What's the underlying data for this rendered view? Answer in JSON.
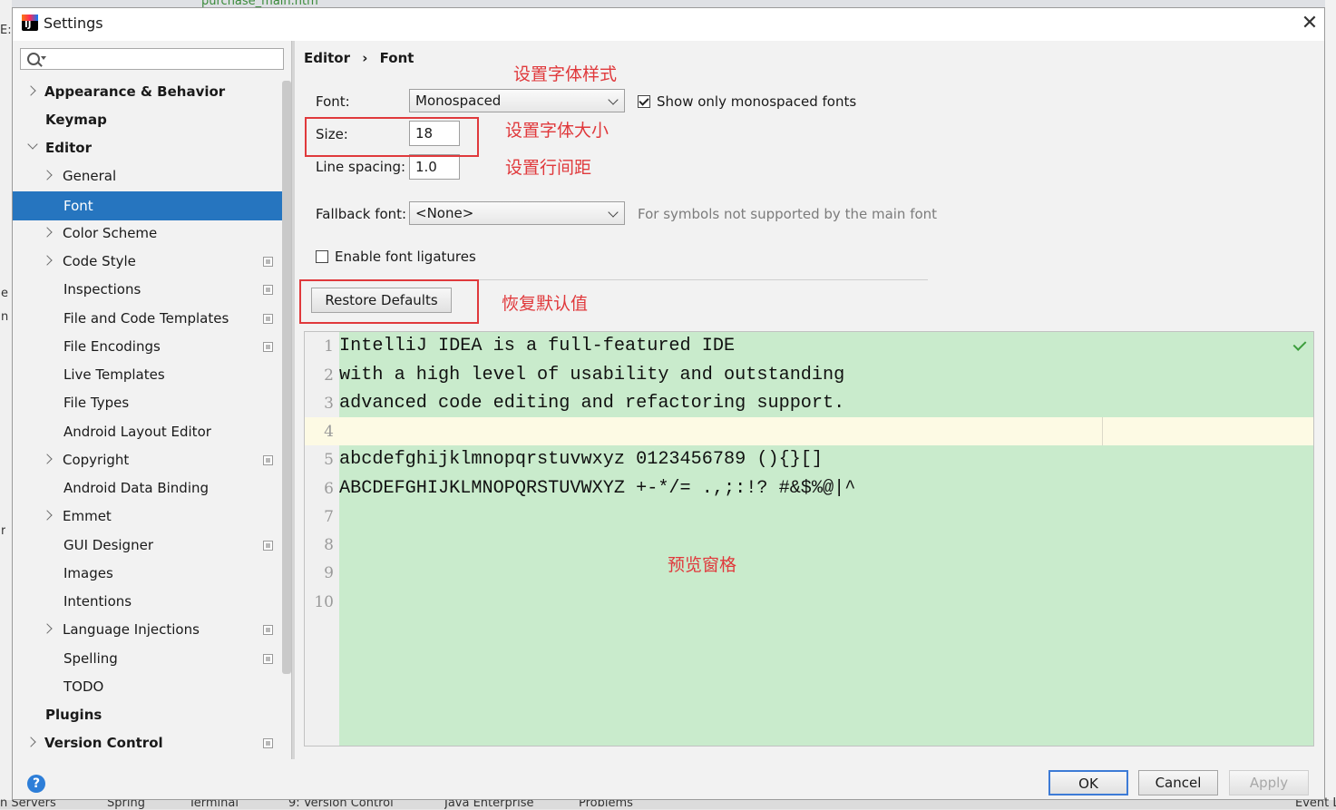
{
  "background": {
    "top_tab": "purchase_main.htm",
    "left_fragments": [
      "E:",
      "e",
      "n",
      "r"
    ],
    "right_fragments": [],
    "bottom_tabs": [
      "n Servers",
      "Spring",
      "Terminal",
      "9: Version Control",
      "Java Enterprise",
      "Problems",
      "Event L"
    ]
  },
  "dialog": {
    "title": "Settings",
    "close_glyph": "✕",
    "help_glyph": "?"
  },
  "tree": {
    "search_placeholder": "",
    "items": [
      {
        "label": "Appearance & Behavior"
      },
      {
        "label": "Keymap"
      },
      {
        "label": "Editor"
      },
      {
        "label": "General"
      },
      {
        "label": "Font"
      },
      {
        "label": "Color Scheme"
      },
      {
        "label": "Code Style"
      },
      {
        "label": "Inspections"
      },
      {
        "label": "File and Code Templates"
      },
      {
        "label": "File Encodings"
      },
      {
        "label": "Live Templates"
      },
      {
        "label": "File Types"
      },
      {
        "label": "Android Layout Editor"
      },
      {
        "label": "Copyright"
      },
      {
        "label": "Android Data Binding"
      },
      {
        "label": "Emmet"
      },
      {
        "label": "GUI Designer"
      },
      {
        "label": "Images"
      },
      {
        "label": "Intentions"
      },
      {
        "label": "Language Injections"
      },
      {
        "label": "Spelling"
      },
      {
        "label": "TODO"
      },
      {
        "label": "Plugins"
      },
      {
        "label": "Version Control"
      }
    ]
  },
  "breadcrumb": {
    "parent": "Editor",
    "separator": "›",
    "current": "Font"
  },
  "font_settings": {
    "font_label": "Font:",
    "font_value": "Monospaced",
    "mono_only_label": "Show only monospaced fonts",
    "mono_only_checked": true,
    "size_label": "Size:",
    "size_value": "18",
    "line_spacing_label": "Line spacing:",
    "line_spacing_value": "1.0",
    "fallback_label": "Fallback font:",
    "fallback_value": "<None>",
    "fallback_hint": "For symbols not supported by the main font",
    "ligatures_label": "Enable font ligatures",
    "ligatures_checked": false,
    "restore_label": "Restore Defaults"
  },
  "annotations": {
    "font_style": "设置字体样式",
    "font_size": "设置字体大小",
    "line_spacing": "设置行间距",
    "restore": "恢复默认值",
    "preview": "预览窗格"
  },
  "preview": {
    "lines": [
      {
        "num": "1",
        "text": "IntelliJ IDEA is a full-featured IDE"
      },
      {
        "num": "2",
        "text": "with a high level of usability and outstanding"
      },
      {
        "num": "3",
        "text": "advanced code editing and refactoring support."
      },
      {
        "num": "4",
        "text": ""
      },
      {
        "num": "5",
        "text": "abcdefghijklmnopqrstuvwxyz 0123456789 (){}[]"
      },
      {
        "num": "6",
        "text": "ABCDEFGHIJKLMNOPQRSTUVWXYZ +-*/= .,;:!? #&$%@|^"
      },
      {
        "num": "7",
        "text": ""
      },
      {
        "num": "8",
        "text": ""
      },
      {
        "num": "9",
        "text": ""
      },
      {
        "num": "10",
        "text": ""
      }
    ]
  },
  "buttons": {
    "ok": "OK",
    "cancel": "Cancel",
    "apply": "Apply"
  },
  "colors": {
    "selection": "#2675bf",
    "preview_bg": "#c9ebcc",
    "annotation": "#e0393c"
  }
}
